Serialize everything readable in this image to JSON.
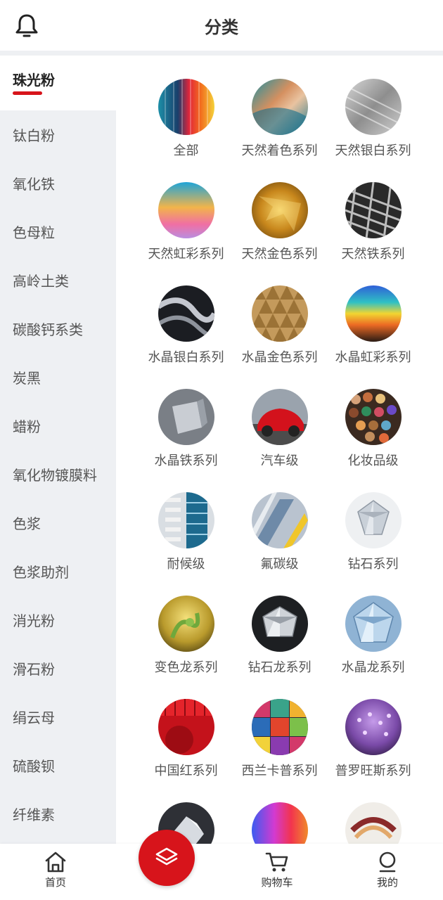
{
  "header": {
    "title": "分类"
  },
  "sidebar": {
    "items": [
      {
        "label": "珠光粉"
      },
      {
        "label": "钛白粉"
      },
      {
        "label": "氧化铁"
      },
      {
        "label": "色母粒"
      },
      {
        "label": "高岭土类"
      },
      {
        "label": "碳酸钙系类"
      },
      {
        "label": "炭黑"
      },
      {
        "label": "蜡粉"
      },
      {
        "label": "氧化物镀膜料"
      },
      {
        "label": "色浆"
      },
      {
        "label": "色浆助剂"
      },
      {
        "label": "消光粉"
      },
      {
        "label": "滑石粉"
      },
      {
        "label": "绢云母"
      },
      {
        "label": "硫酸钡"
      },
      {
        "label": "纤维素"
      }
    ]
  },
  "categories": [
    {
      "label": "全部"
    },
    {
      "label": "天然着色系列"
    },
    {
      "label": "天然银白系列"
    },
    {
      "label": "天然虹彩系列"
    },
    {
      "label": "天然金色系列"
    },
    {
      "label": "天然铁系列"
    },
    {
      "label": "水晶银白系列"
    },
    {
      "label": "水晶金色系列"
    },
    {
      "label": "水晶虹彩系列"
    },
    {
      "label": "水晶铁系列"
    },
    {
      "label": "汽车级"
    },
    {
      "label": "化妆品级"
    },
    {
      "label": "耐候级"
    },
    {
      "label": "氟碳级"
    },
    {
      "label": "钻石系列"
    },
    {
      "label": "变色龙系列"
    },
    {
      "label": "钻石龙系列"
    },
    {
      "label": "水晶龙系列"
    },
    {
      "label": "中国红系列"
    },
    {
      "label": "西兰卡普系列"
    },
    {
      "label": "普罗旺斯系列"
    },
    {
      "label": ""
    },
    {
      "label": ""
    },
    {
      "label": ""
    }
  ],
  "tabbar": {
    "items": [
      {
        "label": "首页",
        "icon": "home-icon"
      },
      {
        "label": "",
        "icon": "layers-icon"
      },
      {
        "label": "购物车",
        "icon": "cart-icon"
      },
      {
        "label": "我的",
        "icon": "user-icon"
      }
    ]
  },
  "colors": {
    "accent": "#d7141b",
    "sidebar_bg": "#eef0f3"
  }
}
